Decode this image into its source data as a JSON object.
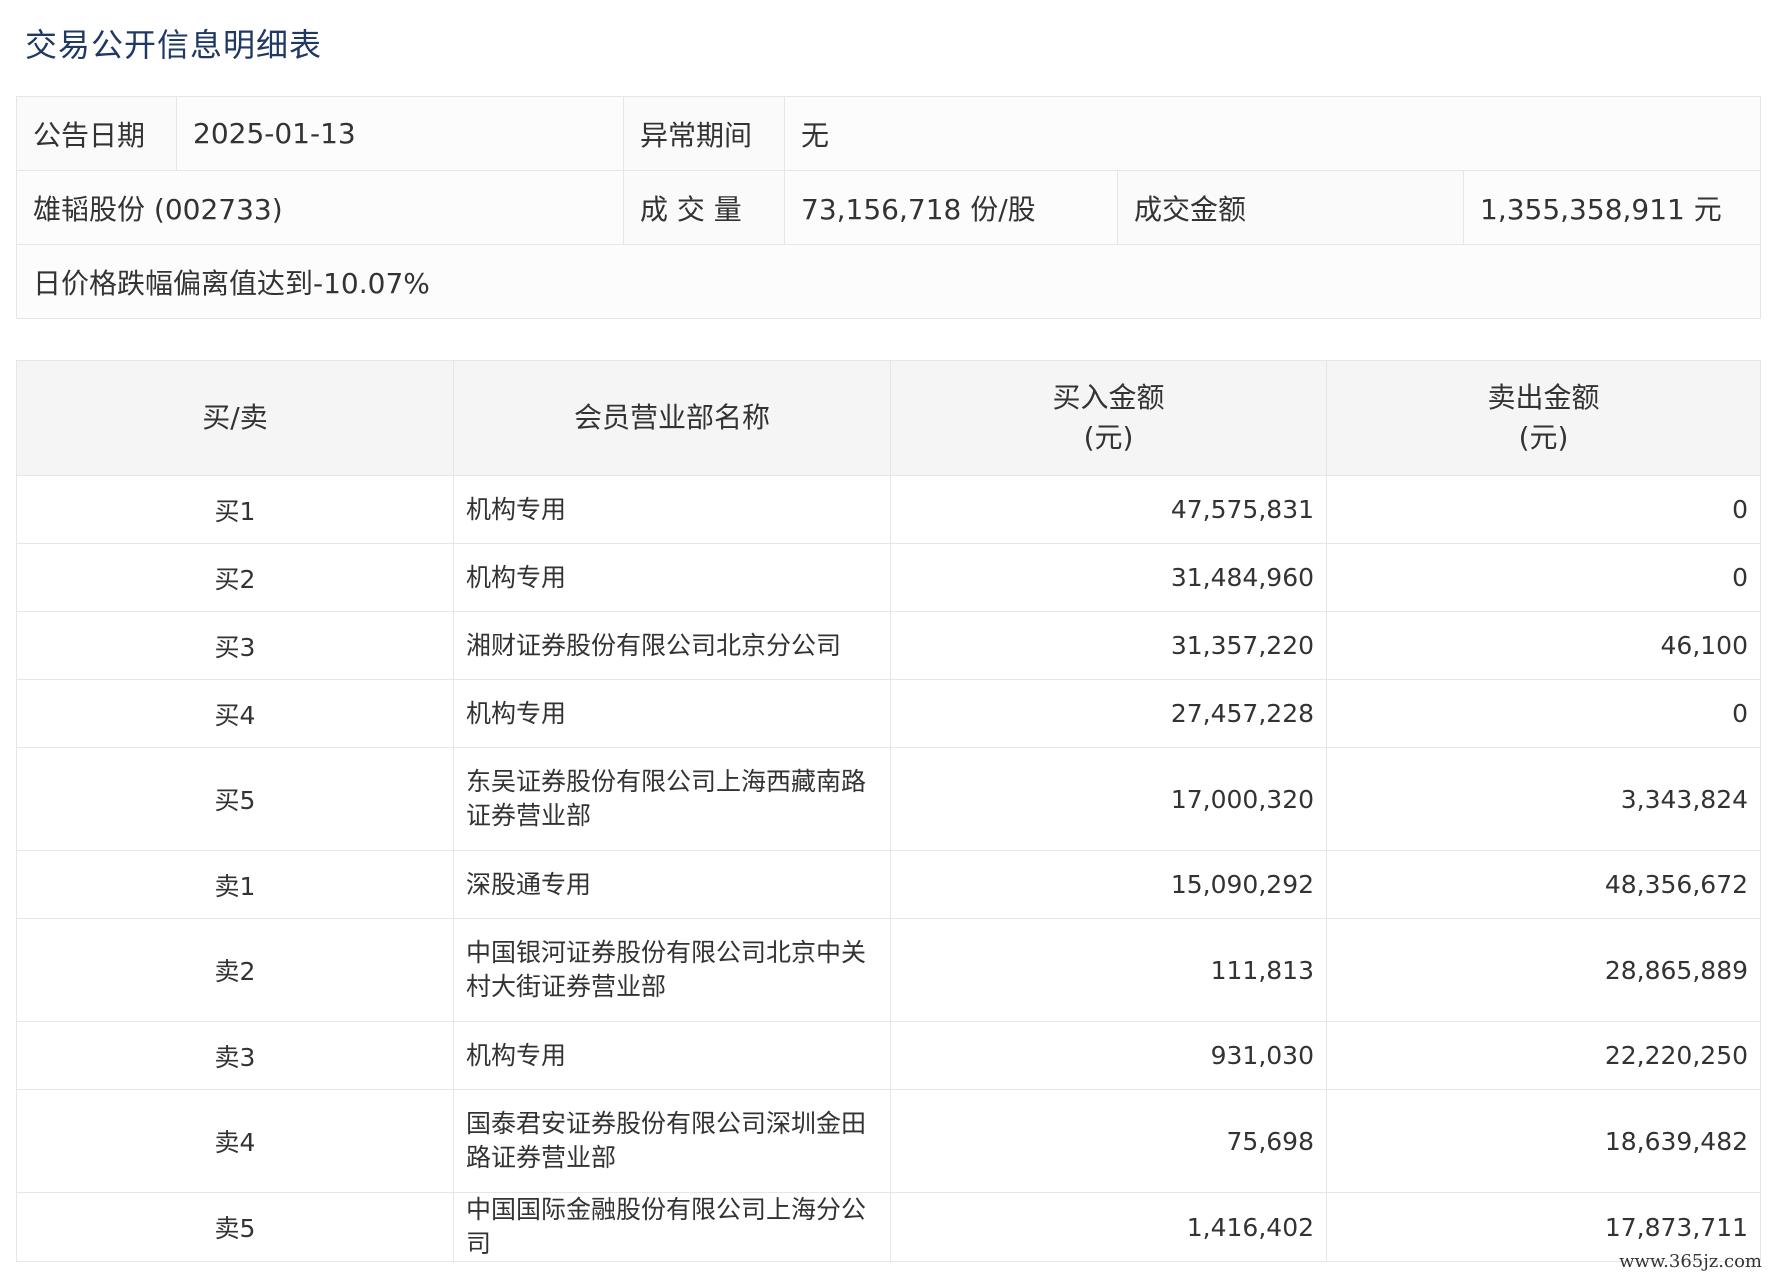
{
  "title": "交易公开信息明细表",
  "info": {
    "date_label": "公告日期",
    "date_value": "2025-01-13",
    "period_label": "异常期间",
    "period_value": "无",
    "stock": "雄韬股份 (002733)",
    "volume_label": "成 交 量",
    "volume_value": "73,156,718 份/股",
    "amount_label": "成交金额",
    "amount_value": "1,355,358,911 元",
    "reason": "日价格跌幅偏离值达到-10.07%"
  },
  "detail": {
    "headers": {
      "side": "买/卖",
      "name": "会员营业部名称",
      "buy_line1": "买入金额",
      "buy_line2": "(元)",
      "sell_line1": "卖出金额",
      "sell_line2": "(元)"
    },
    "rows": [
      {
        "side": "买1",
        "name": "机构专用",
        "buy": "47,575,831",
        "sell": "0"
      },
      {
        "side": "买2",
        "name": "机构专用",
        "buy": "31,484,960",
        "sell": "0"
      },
      {
        "side": "买3",
        "name": "湘财证券股份有限公司北京分公司",
        "buy": "31,357,220",
        "sell": "46,100"
      },
      {
        "side": "买4",
        "name": "机构专用",
        "buy": "27,457,228",
        "sell": "0"
      },
      {
        "side": "买5",
        "name": "东吴证券股份有限公司上海西藏南路证券营业部",
        "buy": "17,000,320",
        "sell": "3,343,824"
      },
      {
        "side": "卖1",
        "name": "深股通专用",
        "buy": "15,090,292",
        "sell": "48,356,672"
      },
      {
        "side": "卖2",
        "name": "中国银河证券股份有限公司北京中关村大街证券营业部",
        "buy": "111,813",
        "sell": "28,865,889"
      },
      {
        "side": "卖3",
        "name": "机构专用",
        "buy": "931,030",
        "sell": "22,220,250"
      },
      {
        "side": "卖4",
        "name": "国泰君安证券股份有限公司深圳金田路证券营业部",
        "buy": "75,698",
        "sell": "18,639,482"
      },
      {
        "side": "卖5",
        "name": "中国国际金融股份有限公司上海分公司",
        "buy": "1,416,402",
        "sell": "17,873,711"
      }
    ]
  },
  "watermark": "www.365jz.com"
}
